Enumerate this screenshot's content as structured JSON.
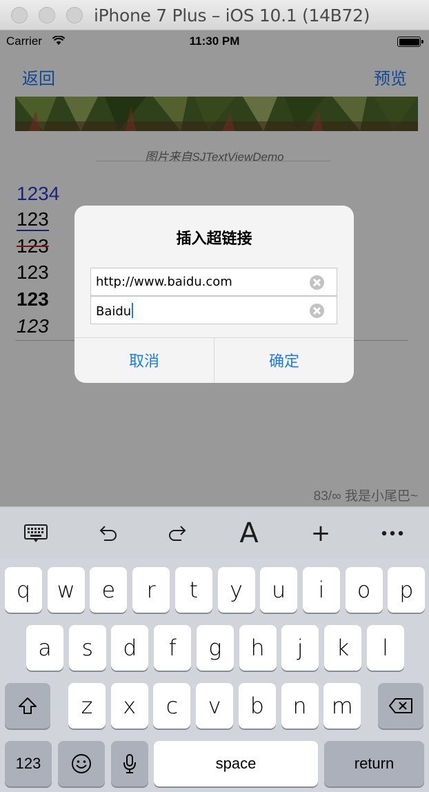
{
  "window": {
    "title": "iPhone 7 Plus – iOS 10.1 (14B72)"
  },
  "status_bar": {
    "carrier": "Carrier",
    "time": "11:30 PM",
    "wifi_icon": "wifi-icon",
    "battery_icon": "battery-icon"
  },
  "nav": {
    "back_label": "返回",
    "preview_label": "预览"
  },
  "content": {
    "image_caption": "图片来自SJTextViewDemo",
    "lines": [
      {
        "text": "1234",
        "style": "blue"
      },
      {
        "text": "123",
        "style": "underline"
      },
      {
        "text": "123",
        "style": "strikethrough"
      },
      {
        "text": "123",
        "style": "plain"
      },
      {
        "text": "123",
        "style": "bold"
      },
      {
        "text": "123",
        "style": "italic"
      }
    ],
    "counter": "83/∞ 我是小尾巴~"
  },
  "alert": {
    "title": "插入超链接",
    "url_value": "http://www.baidu.com",
    "text_value": "Baidu",
    "cancel_label": "取消",
    "confirm_label": "确定"
  },
  "toolbar": {
    "items": [
      "keyboard-icon",
      "undo-icon",
      "redo-icon",
      "font-icon",
      "plus-icon",
      "more-icon"
    ],
    "font_label": "A",
    "plus_label": "+"
  },
  "keyboard": {
    "row1": [
      "q",
      "w",
      "e",
      "r",
      "t",
      "y",
      "u",
      "i",
      "o",
      "p"
    ],
    "row2": [
      "a",
      "s",
      "d",
      "f",
      "g",
      "h",
      "j",
      "k",
      "l"
    ],
    "row3": [
      "z",
      "x",
      "c",
      "v",
      "b",
      "n",
      "m"
    ],
    "numbers_label": "123",
    "space_label": "space",
    "return_label": "return"
  },
  "colors": {
    "accent": "#1a7cf0",
    "blue_text": "#2b3ed1",
    "strike": "#d21a1a",
    "keyboard_bg": "#d1d5db"
  }
}
